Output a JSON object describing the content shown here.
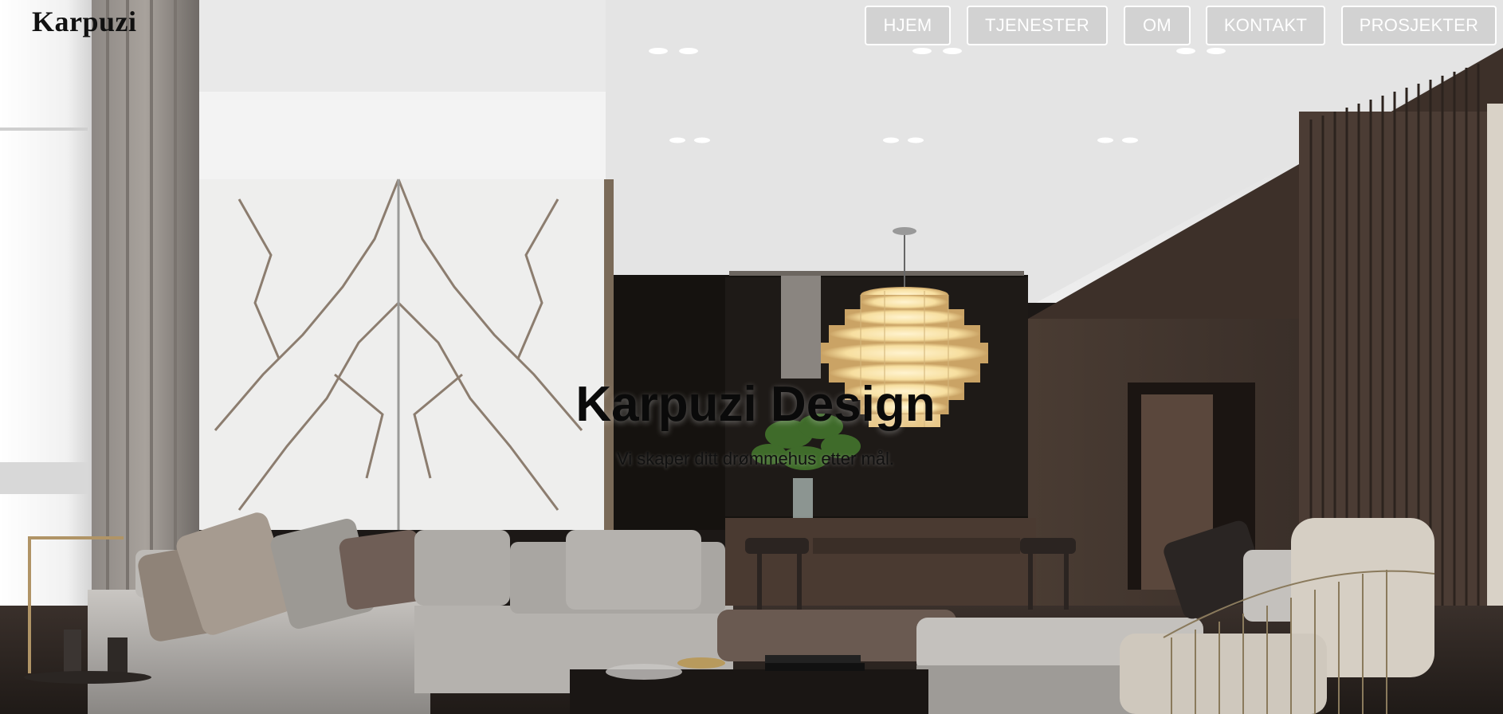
{
  "header": {
    "logo": "Karpuzi",
    "nav": [
      {
        "label": "HJEM"
      },
      {
        "label": "TJENESTER"
      },
      {
        "label": "OM"
      },
      {
        "label": "KONTAKT"
      },
      {
        "label": "PROSJEKTER"
      }
    ]
  },
  "hero": {
    "title": "Karpuzi Design",
    "subtitle": "Vi skaper ditt drømmehus etter mål."
  },
  "background": {
    "description_icon": "interior-living-room-image"
  }
}
